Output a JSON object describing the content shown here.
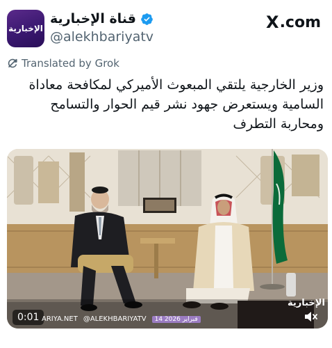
{
  "account": {
    "avatar_text": "الإخبارية",
    "display_name": "قناة الإخبارية",
    "handle": "@alekhbariyatv",
    "verified_icon": "verified-badge-icon"
  },
  "site": {
    "x_mark": "X",
    "domain": ".com"
  },
  "translation": {
    "label": "Translated by Grok",
    "icon": "translate-icon"
  },
  "tweet": {
    "text": "وزير الخارجية يلتقي المبعوث الأميركي لمكافحة معاداة السامية ويستعرض جهود نشر قيم الحوار والتسامح ومحاربة التطرف"
  },
  "video": {
    "timecode": "0:01",
    "ticker_site": "ARIYA.NET",
    "ticker_handle": "@ALEKHBARIYATV",
    "ticker_date": "14 فبراير 2026",
    "channel_bug": "الإخبارية",
    "mute_icon": "speaker-muted-icon"
  },
  "colors": {
    "brand_purple": "#4a2080",
    "text_primary": "#0f1419",
    "text_secondary": "#536471",
    "verified_blue": "#1d9bf0",
    "flag_green": "#0b6b3a"
  }
}
